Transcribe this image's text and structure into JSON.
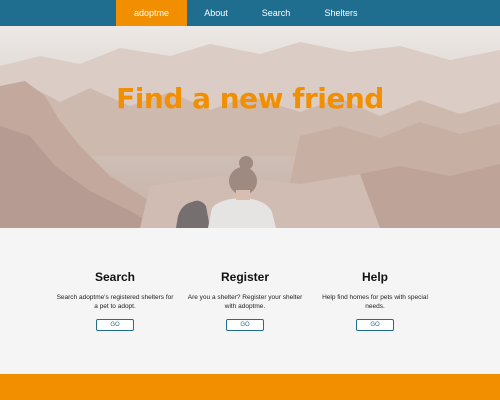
{
  "nav": {
    "brand": "adoptme",
    "items": [
      "About",
      "Search",
      "Shelters"
    ]
  },
  "hero": {
    "title": "Find a new friend"
  },
  "features": [
    {
      "title": "Search",
      "text": "Search adoptme's registered shelters for a pet to adopt.",
      "button": "GO"
    },
    {
      "title": "Register",
      "text": "Are you a shelter? Register your shelter with adoptme.",
      "button": "GO"
    },
    {
      "title": "Help",
      "text": "Help find homes for pets with special needs.",
      "button": "GO"
    }
  ],
  "colors": {
    "primary": "#1f6d8f",
    "accent": "#f28f00",
    "background": "#f5f5f5"
  }
}
